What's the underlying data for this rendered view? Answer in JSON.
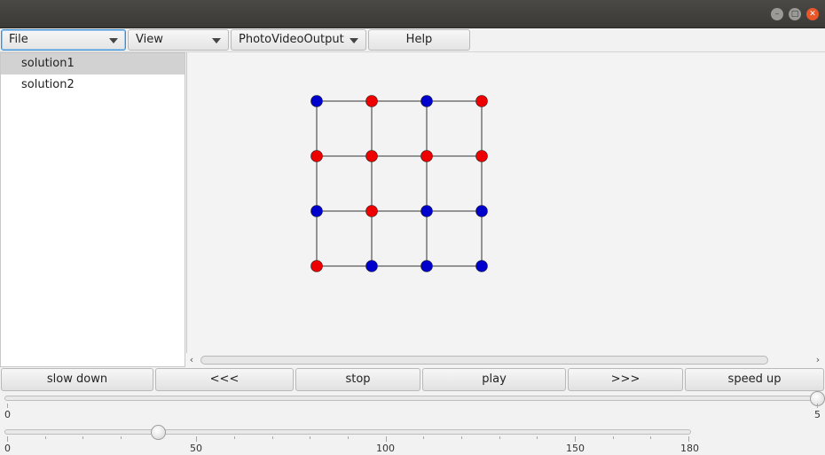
{
  "window": {
    "controls": [
      "minimize",
      "maximize",
      "close"
    ]
  },
  "menubar": {
    "file": "File",
    "view": "View",
    "photo": "PhotoVideoOutput",
    "help": "Help"
  },
  "sidebar": {
    "items": [
      {
        "label": "solution1",
        "selected": true
      },
      {
        "label": "solution2",
        "selected": false
      }
    ]
  },
  "canvas": {
    "grid_rows": 4,
    "grid_cols": 4,
    "colors": {
      "red": "#ee0000",
      "blue": "#0000cc",
      "line": "#333333"
    },
    "node_colors": [
      [
        "blue",
        "red",
        "blue",
        "red"
      ],
      [
        "red",
        "red",
        "red",
        "red"
      ],
      [
        "blue",
        "red",
        "blue",
        "blue"
      ],
      [
        "red",
        "blue",
        "blue",
        "blue"
      ]
    ]
  },
  "controls": {
    "slow_down": "slow down",
    "prev": "<<<",
    "stop": "stop",
    "play": "play",
    "next": ">>>",
    "speed_up": "speed up"
  },
  "speed_slider": {
    "min": 0,
    "max": 5,
    "value": 5,
    "min_label": "0",
    "max_label": "5"
  },
  "frame_slider": {
    "min": 0,
    "max": 180,
    "value": 40,
    "labels": [
      "0",
      "50",
      "100",
      "150",
      "180"
    ]
  }
}
